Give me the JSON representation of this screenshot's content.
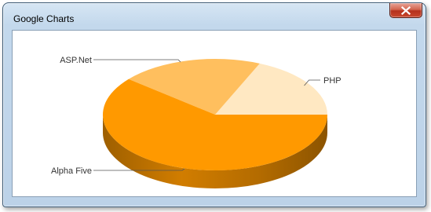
{
  "window": {
    "title": "Google Charts"
  },
  "icons": {
    "close": "close-icon"
  },
  "chart_data": {
    "type": "pie",
    "is3D": true,
    "slices": [
      {
        "label": "PHP",
        "value": 18.5,
        "color": "#FFE8C2"
      },
      {
        "label": "ASP.Net",
        "value": 20.5,
        "color": "#FFBF5E"
      },
      {
        "label": "Alpha Five",
        "value": 61.0,
        "color": "#FF9900"
      }
    ],
    "title": "",
    "legend": "labeled"
  }
}
